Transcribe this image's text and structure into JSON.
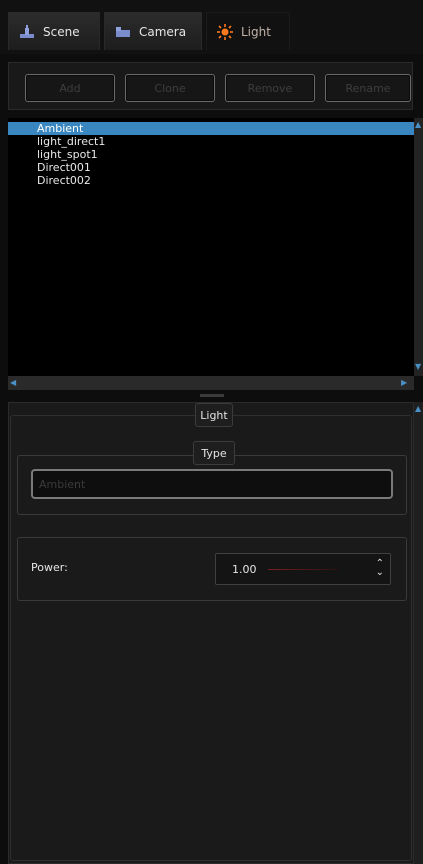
{
  "tabs": [
    {
      "label": "Scene",
      "icon": "scene-icon"
    },
    {
      "label": "Camera",
      "icon": "camera-icon"
    },
    {
      "label": "Light",
      "icon": "light-icon"
    }
  ],
  "toolbar": {
    "add_label": "Add",
    "clone_label": "Clone",
    "remove_label": "Remove",
    "rename_label": "Rename"
  },
  "lights": {
    "items": [
      "Ambient",
      "light_direct1",
      "light_spot1",
      "Direct001",
      "Direct002"
    ],
    "selected": "Ambient"
  },
  "properties": {
    "group_title": "Light",
    "type_title": "Type",
    "type_value": "Ambient",
    "power_label": "Power:",
    "power_value": "1.00"
  },
  "colors": {
    "selection": "#3a86c0",
    "active_tab_icon": "#ff7a1a"
  }
}
